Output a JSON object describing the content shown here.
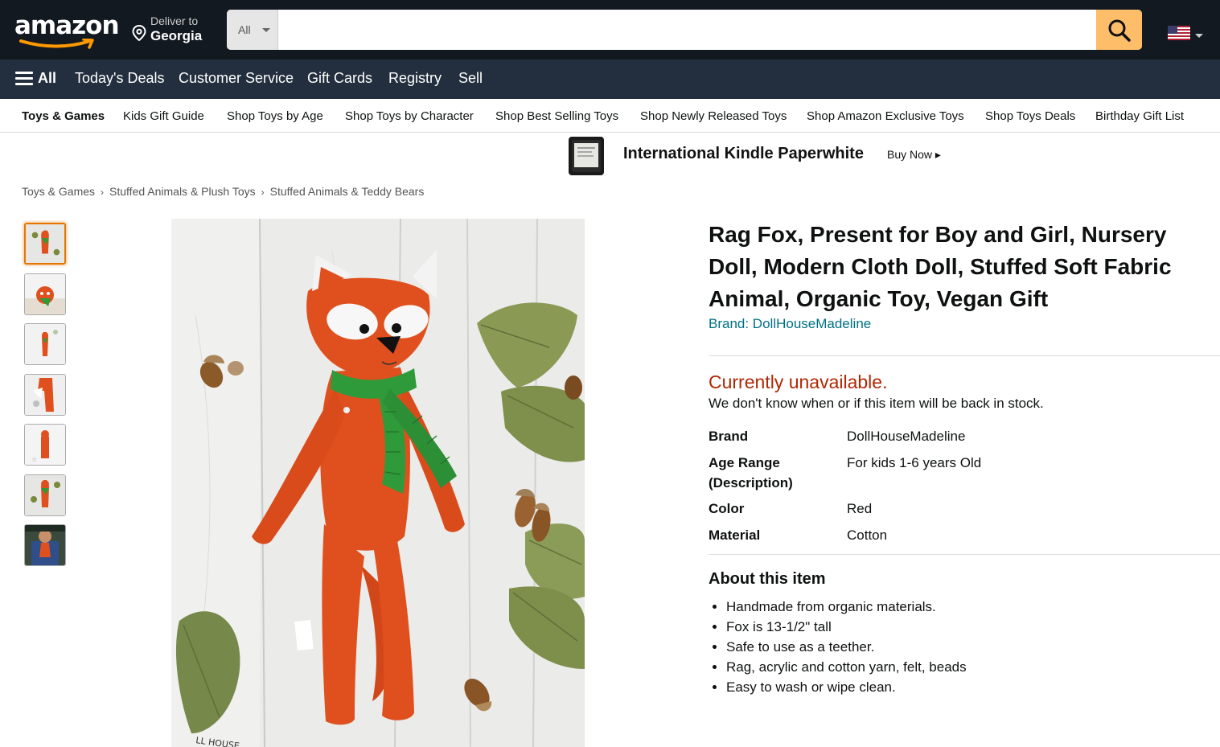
{
  "header": {
    "logo_text": "amazon",
    "deliver_line1": "Deliver to",
    "deliver_line2": "Georgia",
    "search_category": "All",
    "search_placeholder": "",
    "flag": "us-flag-icon"
  },
  "nav": {
    "all_label": "All",
    "links": [
      "Today's Deals",
      "Customer Service",
      "Gift Cards",
      "Registry",
      "Sell"
    ]
  },
  "subnav": {
    "items": [
      "Toys & Games",
      "Kids Gift Guide",
      "Shop Toys by Age",
      "Shop Toys by Character",
      "Shop Best Selling Toys",
      "Shop Newly Released Toys",
      "Shop Amazon Exclusive Toys",
      "Shop Toys Deals",
      "Birthday Gift List"
    ]
  },
  "ad": {
    "title": "International Kindle Paperwhite",
    "cta": "Buy Now ▸"
  },
  "breadcrumb": [
    "Toys & Games",
    "Stuffed Animals & Plush Toys",
    "Stuffed Animals & Teddy Bears"
  ],
  "breadcrumb_sep": "›",
  "product": {
    "title": "Rag Fox, Present for Boy and Girl, Nursery Doll, Modern Cloth Doll, Stuffed Soft Fabric Animal, Organic Toy, Vegan Gift",
    "brand_link": "Brand: DollHouseMadeline",
    "availability": "Currently unavailable.",
    "availability_note": "We don't know when or if this item will be back in stock.",
    "specs": [
      {
        "key": "Brand",
        "value": "DollHouseMadeline"
      },
      {
        "key": "Age Range (Description)",
        "value": "For kids 1-6 years Old"
      },
      {
        "key": "Color",
        "value": "Red"
      },
      {
        "key": "Material",
        "value": "Cotton"
      }
    ],
    "about_heading": "About this item",
    "bullets": [
      "Handmade from organic materials.",
      "Fox is 13-1/2\" tall",
      "Safe to use as a teether.",
      "Rag, acrylic and cotton yarn, felt, beads",
      "Easy to wash or wipe clean."
    ],
    "image_tag_text": "LL HOUSE"
  },
  "colors": {
    "header_bg": "#131921",
    "nav_bg": "#232f3e",
    "search_button": "#febd69",
    "link": "#007185",
    "unavailable": "#b12704",
    "fox_orange": "#e0501e"
  }
}
